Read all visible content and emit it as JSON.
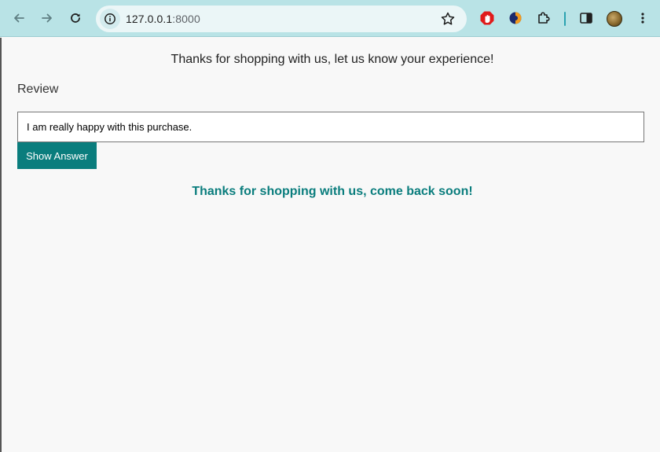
{
  "browser": {
    "url_host": "127.0.0.1",
    "url_port": ":8000",
    "icons": [
      "back-arrow-icon",
      "forward-arrow-icon",
      "reload-icon",
      "site-info-icon",
      "bookmark-star-icon",
      "adblock-extension-icon",
      "extension-icon",
      "puzzle-extensions-icon",
      "side-panel-icon",
      "profile-avatar",
      "kebab-menu-icon"
    ]
  },
  "page": {
    "intro_text": "Thanks for shopping with us, let us know your experience!",
    "review_label": "Review",
    "review_value": "I am really happy with this purchase.",
    "button_label": "Show Answer",
    "result_text": "Thanks for shopping with us, come back soon!"
  },
  "colors": {
    "toolbar": "#b9e3e6",
    "accent": "#0a7d7d"
  }
}
